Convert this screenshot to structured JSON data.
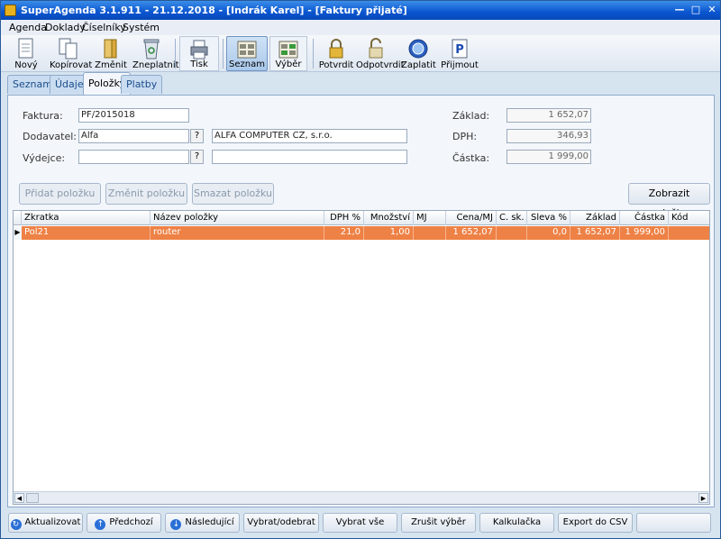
{
  "window": {
    "title": "SuperAgenda 3.1.911 - 21.12.2018 - [Indrák Karel] - [Faktury přijaté]"
  },
  "menu": [
    "Agenda",
    "Doklady",
    "Číselníky",
    "Systém"
  ],
  "toolbar": {
    "novy": "Nový",
    "kopirovat": "Kopírovat",
    "zmenit": "Změnit",
    "zneplatnit": "Zneplatnit",
    "tisk": "Tisk",
    "seznam": "Seznam",
    "vyber": "Výběr",
    "potvrdit": "Potvrdit",
    "odpotvrdit": "Odpotvrdit",
    "zaplatit": "Zaplatit",
    "prijmout": "Přijmout"
  },
  "tabs": [
    "Seznam",
    "Údaje",
    "Položky",
    "Platby"
  ],
  "form": {
    "faktura_label": "Faktura:",
    "faktura_value": "PF/2015018",
    "dodavatel_label": "Dodavatel:",
    "dodavatel_value": "Alfa",
    "dodavatel_name": "ALFA COMPUTER CZ, s.r.o.",
    "vydejce_label": "Výdejce:",
    "vydejce_value": "",
    "vydejce_name": "",
    "help": "?",
    "zaklad_label": "Základ:",
    "zaklad_value": "1 652,07",
    "dph_label": "DPH:",
    "dph_value": "346,93",
    "castka_label": "Částka:",
    "castka_value": "1 999,00"
  },
  "actions": {
    "pridat": "Přidat položku",
    "zmenit": "Změnit položku",
    "smazat": "Smazat položku",
    "zobrazit": "Zobrazit položku"
  },
  "grid": {
    "headers": [
      "Zkratka",
      "Název položky",
      "DPH %",
      "Množství",
      "MJ",
      "Cena/MJ",
      "C. sk.",
      "Sleva %",
      "Základ",
      "Částka",
      "Kód"
    ],
    "rows": [
      [
        "Pol21",
        "router",
        "21,0",
        "1,00",
        "",
        "1 652,07",
        "",
        "0,0",
        "1 652,07",
        "1 999,00",
        ""
      ]
    ]
  },
  "bottom": {
    "aktualizovat": "Aktualizovat",
    "predchozi": "Předchozí",
    "nasledujici": "Následující",
    "vybrat_odebrat": "Vybrat/odebrat",
    "vybrat_vse": "Vybrat vše",
    "zrusit_vyber": "Zrušit výběr",
    "kalkulacka": "Kalkulačka",
    "export": "Export do CSV"
  },
  "colors": {
    "selected_row": "#ee8145",
    "title_bar": "#0a55d0"
  }
}
